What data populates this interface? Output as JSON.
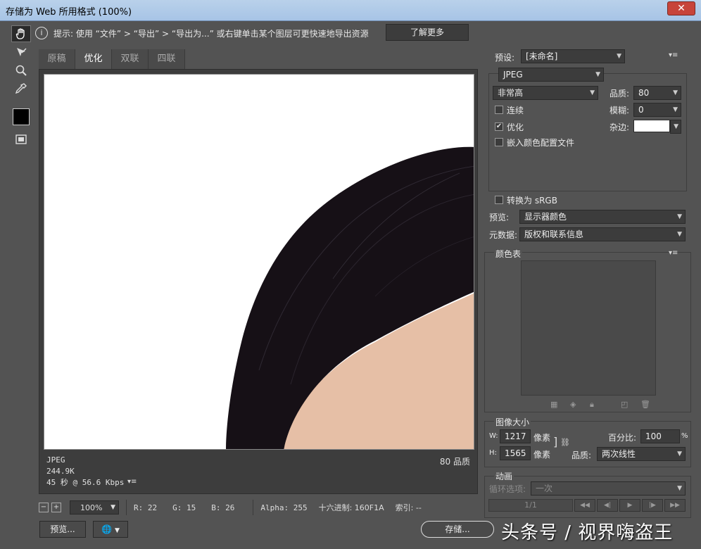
{
  "window": {
    "title": "存储为 Web 所用格式 (100%)",
    "close_label": "✕"
  },
  "tools": [
    {
      "name": "hand-tool-icon",
      "glyph": "✋"
    },
    {
      "name": "slice-select-tool-icon",
      "glyph": "✎"
    },
    {
      "name": "zoom-tool-icon",
      "glyph": "🔍"
    },
    {
      "name": "eyedropper-tool-icon",
      "glyph": "✒"
    }
  ],
  "hint": {
    "icon": "i",
    "text": "提示: 使用 “文件” > “导出” > “导出为...” 或右键单击某个图层可更快速地导出资源",
    "learn_more": "了解更多"
  },
  "tabs": [
    "原稿",
    "优化",
    "双联",
    "四联"
  ],
  "active_tab": 1,
  "preview": {
    "format": "JPEG",
    "size": "244.9K",
    "time": "45 秒 @ 56.6 Kbps",
    "menu_glyph": "▾≡",
    "quality": "80 品质"
  },
  "status": {
    "zoom_out": "−",
    "zoom_in": "+",
    "zoom": "100%",
    "r": "R: 22",
    "g": "G: 15",
    "b": "B: 26",
    "alpha": "Alpha: 255",
    "hex": "十六进制: 160F1A",
    "index": "索引: --"
  },
  "buttons": {
    "preview": "预览...",
    "save": "存储..."
  },
  "settings": {
    "preset_label": "预设:",
    "preset_value": "[未命名]",
    "format": "JPEG",
    "compression": "非常高",
    "quality_label": "品质:",
    "quality_value": "80",
    "blur_label": "模糊:",
    "blur_value": "0",
    "matte_label": "杂边:",
    "progressive_label": "连续",
    "progressive_checked": false,
    "optimized_label": "优化",
    "optimized_checked": true,
    "embed_profile_label": "嵌入颜色配置文件",
    "embed_profile_checked": false,
    "convert_srgb_label": "转换为 sRGB",
    "convert_srgb_checked": false,
    "preview_label": "预览:",
    "preview_value": "显示器颜色",
    "metadata_label": "元数据:",
    "metadata_value": "版权和联系信息"
  },
  "color_table": {
    "title": "颜色表"
  },
  "image_size": {
    "title": "图像大小",
    "w_label": "W:",
    "w_value": "1217",
    "h_label": "H:",
    "h_value": "1565",
    "unit": "像素",
    "percent_label": "百分比:",
    "percent_value": "100",
    "percent_unit": "%",
    "quality_label": "品质:",
    "quality_value": "两次线性"
  },
  "animation": {
    "title": "动画",
    "loop_label": "循环选项:",
    "loop_value": "一次",
    "frame": "1/1"
  },
  "watermark": "头条号 / 视界嗨盗王",
  "colors": {
    "panel": "#535353",
    "field": "#3c3c3c",
    "hair": "#161016",
    "skin": "#e6bfa6"
  }
}
